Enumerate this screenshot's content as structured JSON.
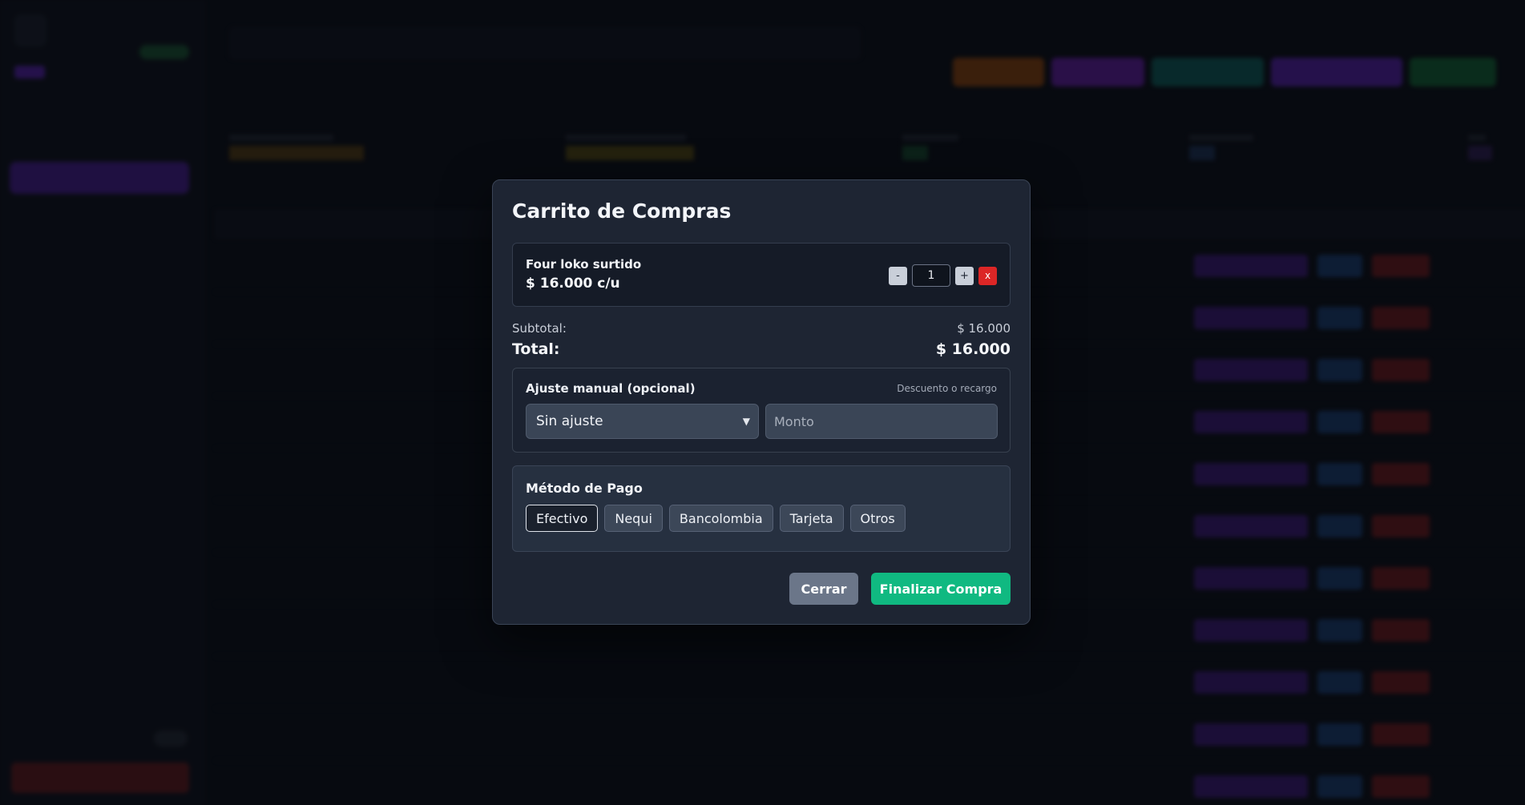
{
  "modal": {
    "title": "Carrito de Compras",
    "items": [
      {
        "name": "Four loko surtido",
        "price": "$ 16.000 c/u",
        "quantity": "1"
      }
    ],
    "controls": {
      "decrement": "-",
      "increment": "+",
      "remove": "x"
    },
    "subtotal_label": "Subtotal:",
    "subtotal_value": "$ 16.000",
    "total_label": "Total:",
    "total_value": "$ 16.000",
    "adjustment": {
      "title": "Ajuste manual (opcional)",
      "hint": "Descuento o recargo",
      "select_value": "Sin ajuste",
      "amount_placeholder": "Monto"
    },
    "payment": {
      "title": "Método de Pago",
      "options": [
        "Efectivo",
        "Nequi",
        "Bancolombia",
        "Tarjeta",
        "Otros"
      ],
      "selected": "Efectivo"
    },
    "buttons": {
      "close": "Cerrar",
      "finish": "Finalizar Compra"
    }
  },
  "colors": {
    "accent_green": "#10b981",
    "danger_red": "#dc2626",
    "modal_bg": "#1e2533"
  }
}
